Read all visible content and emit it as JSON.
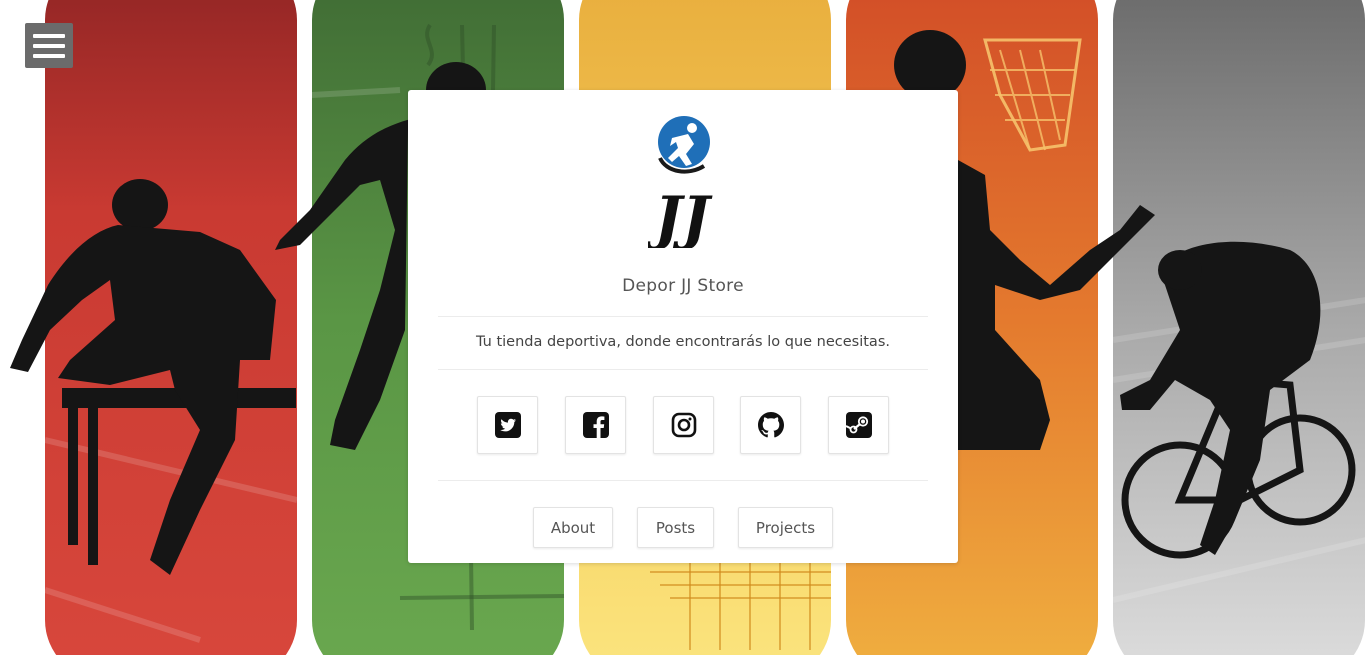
{
  "menu": {
    "icon": "hamburger-icon"
  },
  "card": {
    "logo_icon": "runner-logo-icon",
    "logo_text": "JJ",
    "brand": "Depor JJ Store",
    "tagline": "Tu tienda deportiva, donde encontrarás lo que necesitas."
  },
  "social": [
    {
      "name": "twitter",
      "icon": "twitter-icon"
    },
    {
      "name": "facebook",
      "icon": "facebook-icon"
    },
    {
      "name": "instagram",
      "icon": "instagram-icon"
    },
    {
      "name": "github",
      "icon": "github-icon"
    },
    {
      "name": "steam",
      "icon": "steam-icon"
    }
  ],
  "nav": {
    "about": "About",
    "posts": "Posts",
    "projects": "Projects"
  },
  "background": {
    "panels": [
      {
        "sport": "hurdles",
        "color_top": "#8e2424",
        "color_bottom": "#d8473c"
      },
      {
        "sport": "running",
        "color_top": "#3f6a34",
        "color_bottom": "#6aa84f"
      },
      {
        "sport": "track",
        "color_top": "#e8ad3c",
        "color_bottom": "#fbe57f"
      },
      {
        "sport": "basketball",
        "color_top": "#d14b27",
        "color_bottom": "#f0b040"
      },
      {
        "sport": "cycling",
        "color_top": "#666666",
        "color_bottom": "#dedede"
      }
    ]
  }
}
